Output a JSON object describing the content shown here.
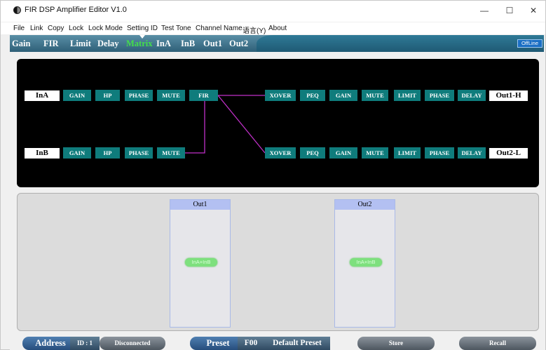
{
  "window": {
    "title": "FIR DSP Amplifier Editor V1.0",
    "controls": {
      "minimize": "—",
      "maximize": "☐",
      "close": "✕"
    }
  },
  "menu": [
    "File",
    "Link",
    "Copy",
    "Lock",
    "Lock Mode",
    "Setting ID",
    "Test Tone",
    "Channel Name",
    "语言(Y)",
    "About"
  ],
  "tabs": [
    "Gain",
    "FIR",
    "Limit",
    "Delay",
    "Matrix",
    "InA",
    "InB",
    "Out1",
    "Out2"
  ],
  "active_tab": "Matrix",
  "status_badge": "OffLine",
  "routing": {
    "inputs": [
      "InA",
      "InB"
    ],
    "input_chain": [
      "GAIN",
      "HP",
      "PHASE",
      "MUTE"
    ],
    "fir_label": "FIR",
    "output_chain": [
      "XOVER",
      "PEQ",
      "GAIN",
      "MUTE",
      "LIMIT",
      "PHASE",
      "DELAY"
    ],
    "outputs": [
      "Out1-H",
      "Out2-L"
    ]
  },
  "matrix": {
    "outputs": [
      {
        "name": "Out1",
        "source": "InA+InB"
      },
      {
        "name": "Out2",
        "source": "InA+InB"
      }
    ]
  },
  "statusbar": {
    "address_label": "Address",
    "id_label": "ID : 1",
    "connection": "Disconnected",
    "preset_label": "Preset",
    "preset_code": "F00",
    "preset_name": "Default Preset",
    "store": "Store",
    "recall": "Recall"
  },
  "colors": {
    "node": "#0f7c7c",
    "wire": "#c030c8",
    "active_tab": "#44e04a",
    "matrix_head": "#b3c0f2",
    "pill": "#7ee07e"
  }
}
